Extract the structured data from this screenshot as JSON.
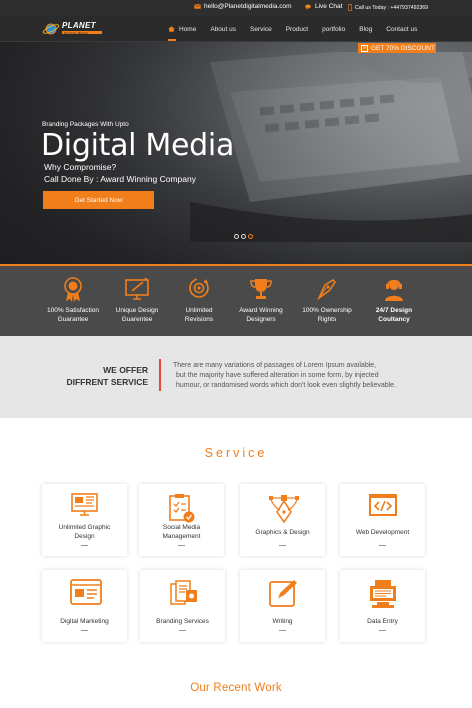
{
  "topbar": {
    "email": "hello@Planetdigitalmedia.com",
    "live_chat": "Live Chat",
    "phone": "Call us Today : +447937492369"
  },
  "brand": {
    "name": "PLANET",
    "tagline": "DIGITAL MEDIA",
    "accent": "#f07e1b"
  },
  "nav": {
    "items": [
      "Home",
      "About us",
      "Service",
      "Product",
      "portfolio",
      "Blog",
      "Contact us"
    ],
    "discount": "GET 70% DISCOUNT"
  },
  "hero": {
    "subtitle": "Branding Packages With Upto",
    "title": "Digital Media",
    "question": "Why Compromise?",
    "call": "Call Done By : Award Winning Company",
    "button": "Get Started Now",
    "slides": 3,
    "active_slide": 3
  },
  "features": [
    {
      "label": "100% Satisfaction\nGuarantee",
      "icon": "medal-icon"
    },
    {
      "label": "Unique Design\nGuarentee",
      "icon": "design-monitor-icon"
    },
    {
      "label": "Unlimited\nRevisions",
      "icon": "revisions-icon"
    },
    {
      "label": "Award Winning\nDesigners",
      "icon": "trophy-icon"
    },
    {
      "label": "100% Ownership\nRights",
      "icon": "pen-nib-icon"
    },
    {
      "label": "24/7 Design\nCoultancy",
      "icon": "support-agent-icon"
    }
  ],
  "offer": {
    "title": "WE OFFER\nDIFFRENT SERVICE",
    "lines": [
      "There are many variations of passages of Lorem Ipsum available,",
      "but the majority have suffered alteration in some form, by injected",
      "humour, or randomised words which don't look even slightly believable."
    ]
  },
  "service": {
    "title": "Service",
    "cards": [
      {
        "label": "Unlimited Graphic\nDesign",
        "icon": "graphic-design-icon"
      },
      {
        "label": "Social Media\nManagement",
        "icon": "clipboard-check-icon"
      },
      {
        "label": "Graphics & Design",
        "icon": "vector-pen-icon"
      },
      {
        "label": "Web Development",
        "icon": "code-window-icon"
      },
      {
        "label": "Digital Marketing",
        "icon": "marketing-window-icon"
      },
      {
        "label": "Branding Services",
        "icon": "branding-docs-icon"
      },
      {
        "label": "Writing",
        "icon": "edit-pencil-icon"
      },
      {
        "label": "Data Entry",
        "icon": "data-entry-icon"
      }
    ]
  },
  "recent_work": {
    "title": "Our Recent  Work"
  }
}
